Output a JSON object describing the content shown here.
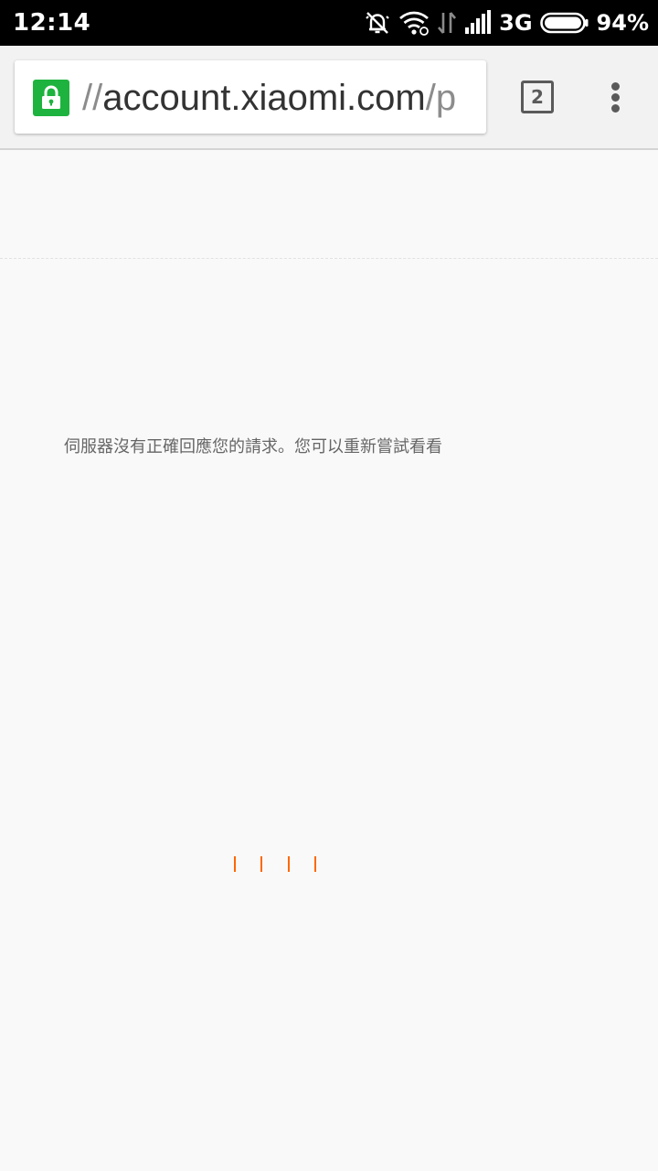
{
  "status_bar": {
    "time": "12:14",
    "network": "3G",
    "battery": "94%",
    "icons": [
      "alarm-off-icon",
      "wifi-icon",
      "data-transfer-icon",
      "signal-icon",
      "battery-icon"
    ],
    "battery_level": 0.94
  },
  "browser": {
    "url_prefix": "//",
    "url_main": "account.xiaomi.com",
    "url_suffix": "/p",
    "tab_count": "2",
    "lock_icon": "lock-icon",
    "lock_color": "#1db33e",
    "menu_icon": "more-vert-icon"
  },
  "page": {
    "error_message": "伺服器沒有正確回應您的請求。您可以重新嘗試看看",
    "loading_color": "#ff6700"
  }
}
